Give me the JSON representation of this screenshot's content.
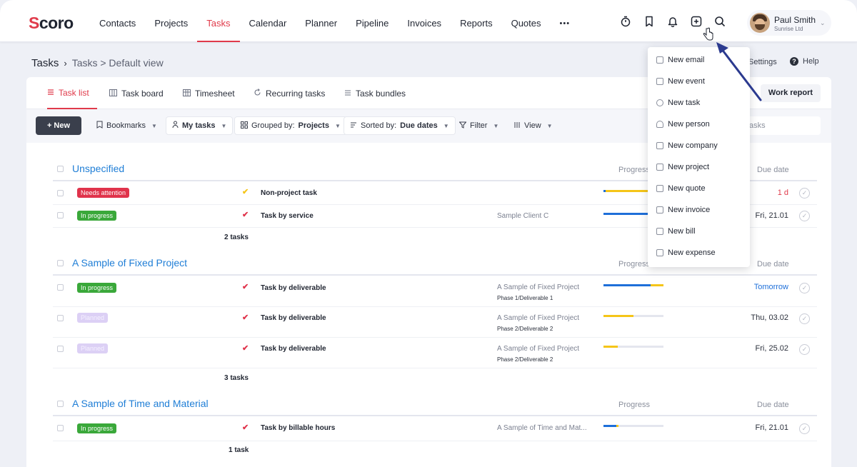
{
  "app": {
    "logo_main": "coro",
    "logo_first": "S"
  },
  "nav": {
    "items": [
      {
        "label": "Contacts"
      },
      {
        "label": "Projects"
      },
      {
        "label": "Tasks"
      },
      {
        "label": "Calendar"
      },
      {
        "label": "Planner"
      },
      {
        "label": "Pipeline"
      },
      {
        "label": "Invoices"
      },
      {
        "label": "Reports"
      },
      {
        "label": "Quotes"
      }
    ],
    "more": "•••",
    "active": "Tasks",
    "icons": [
      "timer-icon",
      "bookmark-icon",
      "bell-icon",
      "plus-square-icon",
      "search-icon"
    ]
  },
  "user": {
    "name": "Paul Smith",
    "company": "Sunrise Ltd"
  },
  "breadcrumb": {
    "title": "Tasks",
    "separator": "›",
    "current": "Tasks > Default view"
  },
  "page_links": {
    "settings": "Settings",
    "help": "Help"
  },
  "tabs": [
    {
      "label": "Task list",
      "icon": "list-icon"
    },
    {
      "label": "Task board",
      "icon": "board-icon"
    },
    {
      "label": "Timesheet",
      "icon": "grid-icon"
    },
    {
      "label": "Recurring tasks",
      "icon": "recurring-icon"
    },
    {
      "label": "Task bundles",
      "icon": "bundle-icon"
    }
  ],
  "work_report": "Work report",
  "toolbar": {
    "new": "New",
    "bookmarks": "Bookmarks",
    "my_tasks": "My tasks",
    "grouped_prefix": "Grouped by:",
    "grouped_value": "Projects",
    "sorted_prefix": "Sorted by:",
    "sorted_value": "Due dates",
    "filter": "Filter",
    "view": "View",
    "search_placeholder": "asks"
  },
  "columns": {
    "progress": "Progress",
    "due": "Due date"
  },
  "colors": {
    "accent": "#e03a4a",
    "link": "#1f7ed6",
    "blue": "#1e6fd9",
    "yellow": "#f5c518"
  },
  "groups": [
    {
      "title": "Unspecified",
      "count": "2 tasks",
      "rows": [
        {
          "status": "Needs attention",
          "task": "Non-project task",
          "client": "",
          "phase": "",
          "due": "1 d",
          "progress_blue": 0.03,
          "progress_yellow": 0.72
        },
        {
          "status": "In progress",
          "task": "Task by service",
          "client": "Sample Client C",
          "phase": "",
          "due": "Fri, 21.01",
          "progress_blue": 0.75,
          "progress_yellow": 0.0
        }
      ]
    },
    {
      "title": "A Sample of Fixed Project",
      "count": "3 tasks",
      "rows": [
        {
          "status": "In progress",
          "task": "Task by deliverable",
          "client": "A Sample of Fixed Project",
          "phase": "Phase 1/Deliverable 1",
          "due": "Tomorrow",
          "progress_blue": 0.78,
          "progress_yellow": 0.22
        },
        {
          "status": "Planned",
          "task": "Task by deliverable",
          "client": "A Sample of Fixed Project",
          "phase": "Phase 2/Deliverable 2",
          "due": "Thu, 03.02",
          "progress_blue": 0.0,
          "progress_yellow": 0.5
        },
        {
          "status": "Planned",
          "task": "Task by deliverable",
          "client": "A Sample of Fixed Project",
          "phase": "Phase 2/Deliverable 2",
          "due": "Fri, 25.02",
          "progress_blue": 0.0,
          "progress_yellow": 0.24
        }
      ]
    },
    {
      "title": "A Sample of Time and Material",
      "count": "1 task",
      "rows": [
        {
          "status": "In progress",
          "task": "Task by billable hours",
          "client": "A Sample of Time and Mat...",
          "phase": "",
          "due": "Fri, 21.01",
          "progress_blue": 0.22,
          "progress_yellow": 0.04
        }
      ]
    }
  ],
  "menu": {
    "items": [
      {
        "label": "New email",
        "icon": "mail-icon"
      },
      {
        "label": "New event",
        "icon": "calendar-icon"
      },
      {
        "label": "New task",
        "icon": "check-circle-icon"
      },
      {
        "label": "New person",
        "icon": "person-icon"
      },
      {
        "label": "New company",
        "icon": "building-icon"
      },
      {
        "label": "New project",
        "icon": "briefcase-icon"
      },
      {
        "label": "New quote",
        "icon": "quote-icon"
      },
      {
        "label": "New invoice",
        "icon": "invoice-icon"
      },
      {
        "label": "New bill",
        "icon": "bill-icon"
      },
      {
        "label": "New expense",
        "icon": "expense-icon"
      }
    ]
  }
}
